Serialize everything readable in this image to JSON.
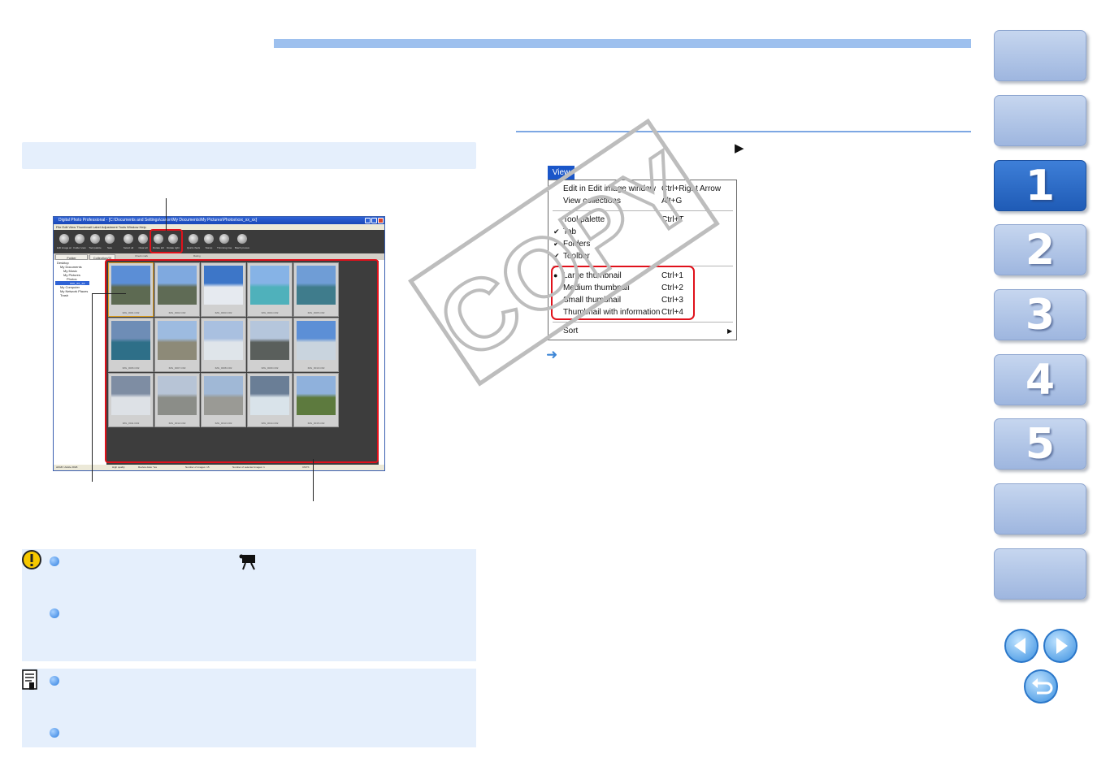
{
  "screenshot": {
    "title": "Digital Photo Professional - [C:\\Documents and Settings\\canon\\My Documents\\My Pictures\\Photos\\xxx_xx_xx]",
    "menu": "File  Edit  View  Thumbnail  Label  Adjustment  Tools  Window  Help",
    "toolbar_labels": [
      "Edit image window",
      "Folder view",
      "Tool palette",
      "Sele",
      "Select all",
      "Clear all",
      "Rotate left",
      "Rotate right",
      "Quick check",
      "Stamp",
      "Trimming image",
      "Batch process"
    ],
    "tab_folder": "Folder",
    "tab_collection": "Collection(0)",
    "check_mark_label": "Check mark",
    "rating_label": "Rating",
    "tree_items": [
      "Desktop",
      "My Documents",
      "My Music",
      "My Pictures",
      "Photos",
      "xxx_xx_xx",
      "My Computer",
      "My Network Places",
      "Trash"
    ],
    "thumbnails": [
      {
        "file": "IMG_0001.CR2",
        "colors": [
          "#5b8ed6",
          "#5d6a52"
        ]
      },
      {
        "file": "IMG_0002.CR2",
        "colors": [
          "#7fa9df",
          "#5f6b55"
        ]
      },
      {
        "file": "IMG_0003.CR2",
        "colors": [
          "#3d76c8",
          "#e6eaf0"
        ]
      },
      {
        "file": "IMG_0004.CR2",
        "colors": [
          "#86b3e6",
          "#4fb1bb"
        ]
      },
      {
        "file": "IMG_0005.CR2",
        "colors": [
          "#6f9dd6",
          "#3f7c8c"
        ]
      },
      {
        "file": "IMG_0006.CR2",
        "colors": [
          "#6e8db6",
          "#2e6f88"
        ]
      },
      {
        "file": "IMG_0007.CR2",
        "colors": [
          "#9dbbe0",
          "#8d8a78"
        ]
      },
      {
        "file": "IMG_0008.CR2",
        "colors": [
          "#a9c0e0",
          "#dfe5ea"
        ]
      },
      {
        "file": "IMG_0009.CR2",
        "colors": [
          "#b5c6dc",
          "#5a5f5c"
        ]
      },
      {
        "file": "IMG_0010.CR2",
        "colors": [
          "#5c8fd6",
          "#c9d4de"
        ]
      },
      {
        "file": "IMG_0011.CR2",
        "colors": [
          "#7e8da3",
          "#dde1e6"
        ]
      },
      {
        "file": "IMG_0012.CR2",
        "colors": [
          "#b7c4d6",
          "#8b8d88"
        ]
      },
      {
        "file": "IMG_0013.CR2",
        "colors": [
          "#a0b8d6",
          "#9a9a95"
        ]
      },
      {
        "file": "IMG_0014.CR2",
        "colors": [
          "#6a7e96",
          "#d9e3ea"
        ]
      },
      {
        "file": "IMG_0015.CR2",
        "colors": [
          "#8fb1dc",
          "#5d7a3e"
        ]
      }
    ],
    "status": [
      "sRGB / Adobe RGB",
      "High quality",
      "Review data: Yes",
      "Number of images: 15",
      "Number of selected images: 1",
      "CMYK"
    ]
  },
  "view_menu": {
    "title": "View",
    "items": [
      {
        "label": "Edit in Edit image window",
        "shortcut": "Ctrl+Right Arrow",
        "mark": ""
      },
      {
        "label": "View collections",
        "shortcut": "Alt+G",
        "mark": ""
      },
      {
        "label": "Tool palette",
        "shortcut": "Ctrl+T",
        "mark": ""
      },
      {
        "label": "Tab",
        "shortcut": "",
        "mark": "✔"
      },
      {
        "label": "Folders",
        "shortcut": "",
        "mark": "✔"
      },
      {
        "label": "Toolbar",
        "shortcut": "",
        "mark": "✔"
      },
      {
        "label": "Large thumbnail",
        "shortcut": "Ctrl+1",
        "mark": "●"
      },
      {
        "label": "Medium thumbnail",
        "shortcut": "Ctrl+2",
        "mark": ""
      },
      {
        "label": "Small thumbnail",
        "shortcut": "Ctrl+3",
        "mark": ""
      },
      {
        "label": "Thumbnail with information",
        "shortcut": "Ctrl+4",
        "mark": ""
      },
      {
        "label": "Sort",
        "shortcut": "",
        "mark": ""
      }
    ],
    "submenu_arrow": "▶"
  },
  "result_arrow": "➜",
  "step_arrow": "▶",
  "watermark": "COPY",
  "nav_tabs": [
    {
      "label": "",
      "active": false
    },
    {
      "label": "",
      "active": false
    },
    {
      "label": "1",
      "active": true
    },
    {
      "label": "2",
      "active": false
    },
    {
      "label": "3",
      "active": false
    },
    {
      "label": "4",
      "active": false
    },
    {
      "label": "5",
      "active": false
    },
    {
      "label": "",
      "active": false
    },
    {
      "label": "",
      "active": false
    }
  ],
  "colors": {
    "accent_blue": "#9dc0ee",
    "highlight_red": "#e0111b",
    "note_background": "#e5effc",
    "active_tab": "#2a67c4"
  },
  "icons": {
    "caution": "caution-icon",
    "memo": "memo-icon",
    "movie": "movie-camera-icon",
    "prev": "previous-page-icon",
    "next": "next-page-icon",
    "back": "return-icon"
  }
}
